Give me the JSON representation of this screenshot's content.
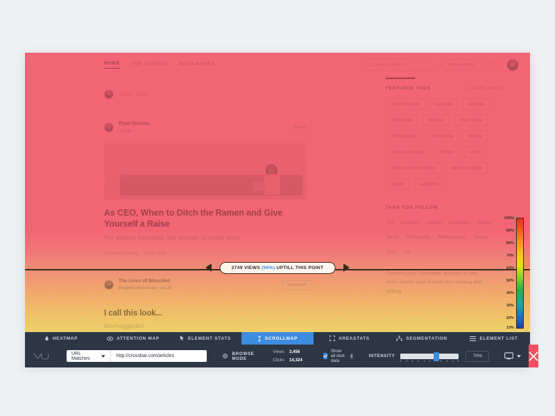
{
  "nav": {
    "links": [
      {
        "label": "HOME",
        "active": true
      },
      {
        "label": "TOP STORIES",
        "active": false
      },
      {
        "label": "BOOKMARKS",
        "active": false
      }
    ],
    "search_placeholder": "Search Medium",
    "write_label": "Write a story"
  },
  "compose": {
    "placeholder": "Write here..."
  },
  "posts": [
    {
      "author": "Ryan Holmes",
      "date": "Jul 20",
      "tag": "Startup",
      "title": "As CEO, When to Ditch the Ramen and Give Yourself a Raise",
      "subtitle": "For startup founders, the answer is rarely easy.",
      "continue": "Continue reading",
      "readtime": "3 min read"
    },
    {
      "publication": "The Lines of Blaschko",
      "author_line": "Eugenio Hanoman / Jul 20",
      "tag": "Inspiration",
      "title": "I call this look...",
      "subtitle": "Momaggedon."
    }
  ],
  "sidebar": {
    "featured_title": "FEATURED TAGS",
    "learn_more": "LEARN MORE",
    "featured_tags": [
      "ICallThisLook",
      "Comedy",
      "Gaming",
      "Millennials",
      "Movies",
      "Short Story",
      "Photography",
      "Parenting",
      "Dating",
      "Climate Change",
      "Fiction",
      "Uber",
      "What I Do For Money",
      "Venture Capital",
      "Japan",
      "Lafayette"
    ],
    "follow_title": "TAGS YOU FOLLOW",
    "follow_tags": [
      "Art",
      "Creativity",
      "Design",
      "Inspiration",
      "Mobile",
      "Music",
      "Productivity",
      "Relationships",
      "Startup",
      "Tech",
      "UX"
    ],
    "facebook_note": "Connect your Facebook account to see more stories your friends are reading and writing."
  },
  "scrollmap": {
    "badge_prefix": "2749 VIEWS",
    "badge_pct": "(96%)",
    "badge_suffix": "UPTILL THIS POINT",
    "legend_ticks": [
      "100%",
      "90%",
      "80%",
      "70%",
      "60%",
      "50%",
      "40%",
      "30%",
      "20%",
      "10%"
    ]
  },
  "toolbar": {
    "tabs": [
      {
        "label": "HEATMAP",
        "icon": "flame-icon",
        "active": false
      },
      {
        "label": "ATTENTION MAP",
        "icon": "eye-icon",
        "active": false
      },
      {
        "label": "ELEMENT STATS",
        "icon": "cursor-icon",
        "active": false
      },
      {
        "label": "SCROLLMAP",
        "icon": "updown-arrow-icon",
        "active": true
      },
      {
        "label": "AREASTATS",
        "icon": "frame-icon",
        "active": false
      },
      {
        "label": "SEGMENTATION",
        "icon": "tree-icon",
        "active": false
      },
      {
        "label": "ELEMENT LIST",
        "icon": "list-icon",
        "active": false
      }
    ],
    "url_match_label": "URL Matches",
    "url_value": "http://crossbar.com/articles",
    "browse_label": "BROWSE MODE",
    "views_label": "Views",
    "views_value": "3,456",
    "clicks_label": "Clicks",
    "clicks_value": "14,324",
    "show_click_data": "Show all click data",
    "intensity_label": "INTENSITY",
    "intensity_value": "70%"
  },
  "colors": {
    "heat_top": "#f2606f",
    "heat_bottom": "#ecdf6e",
    "accent_blue": "#3d8ce0",
    "toolbar_bg": "#2d3644",
    "close_red": "#ef5160"
  }
}
